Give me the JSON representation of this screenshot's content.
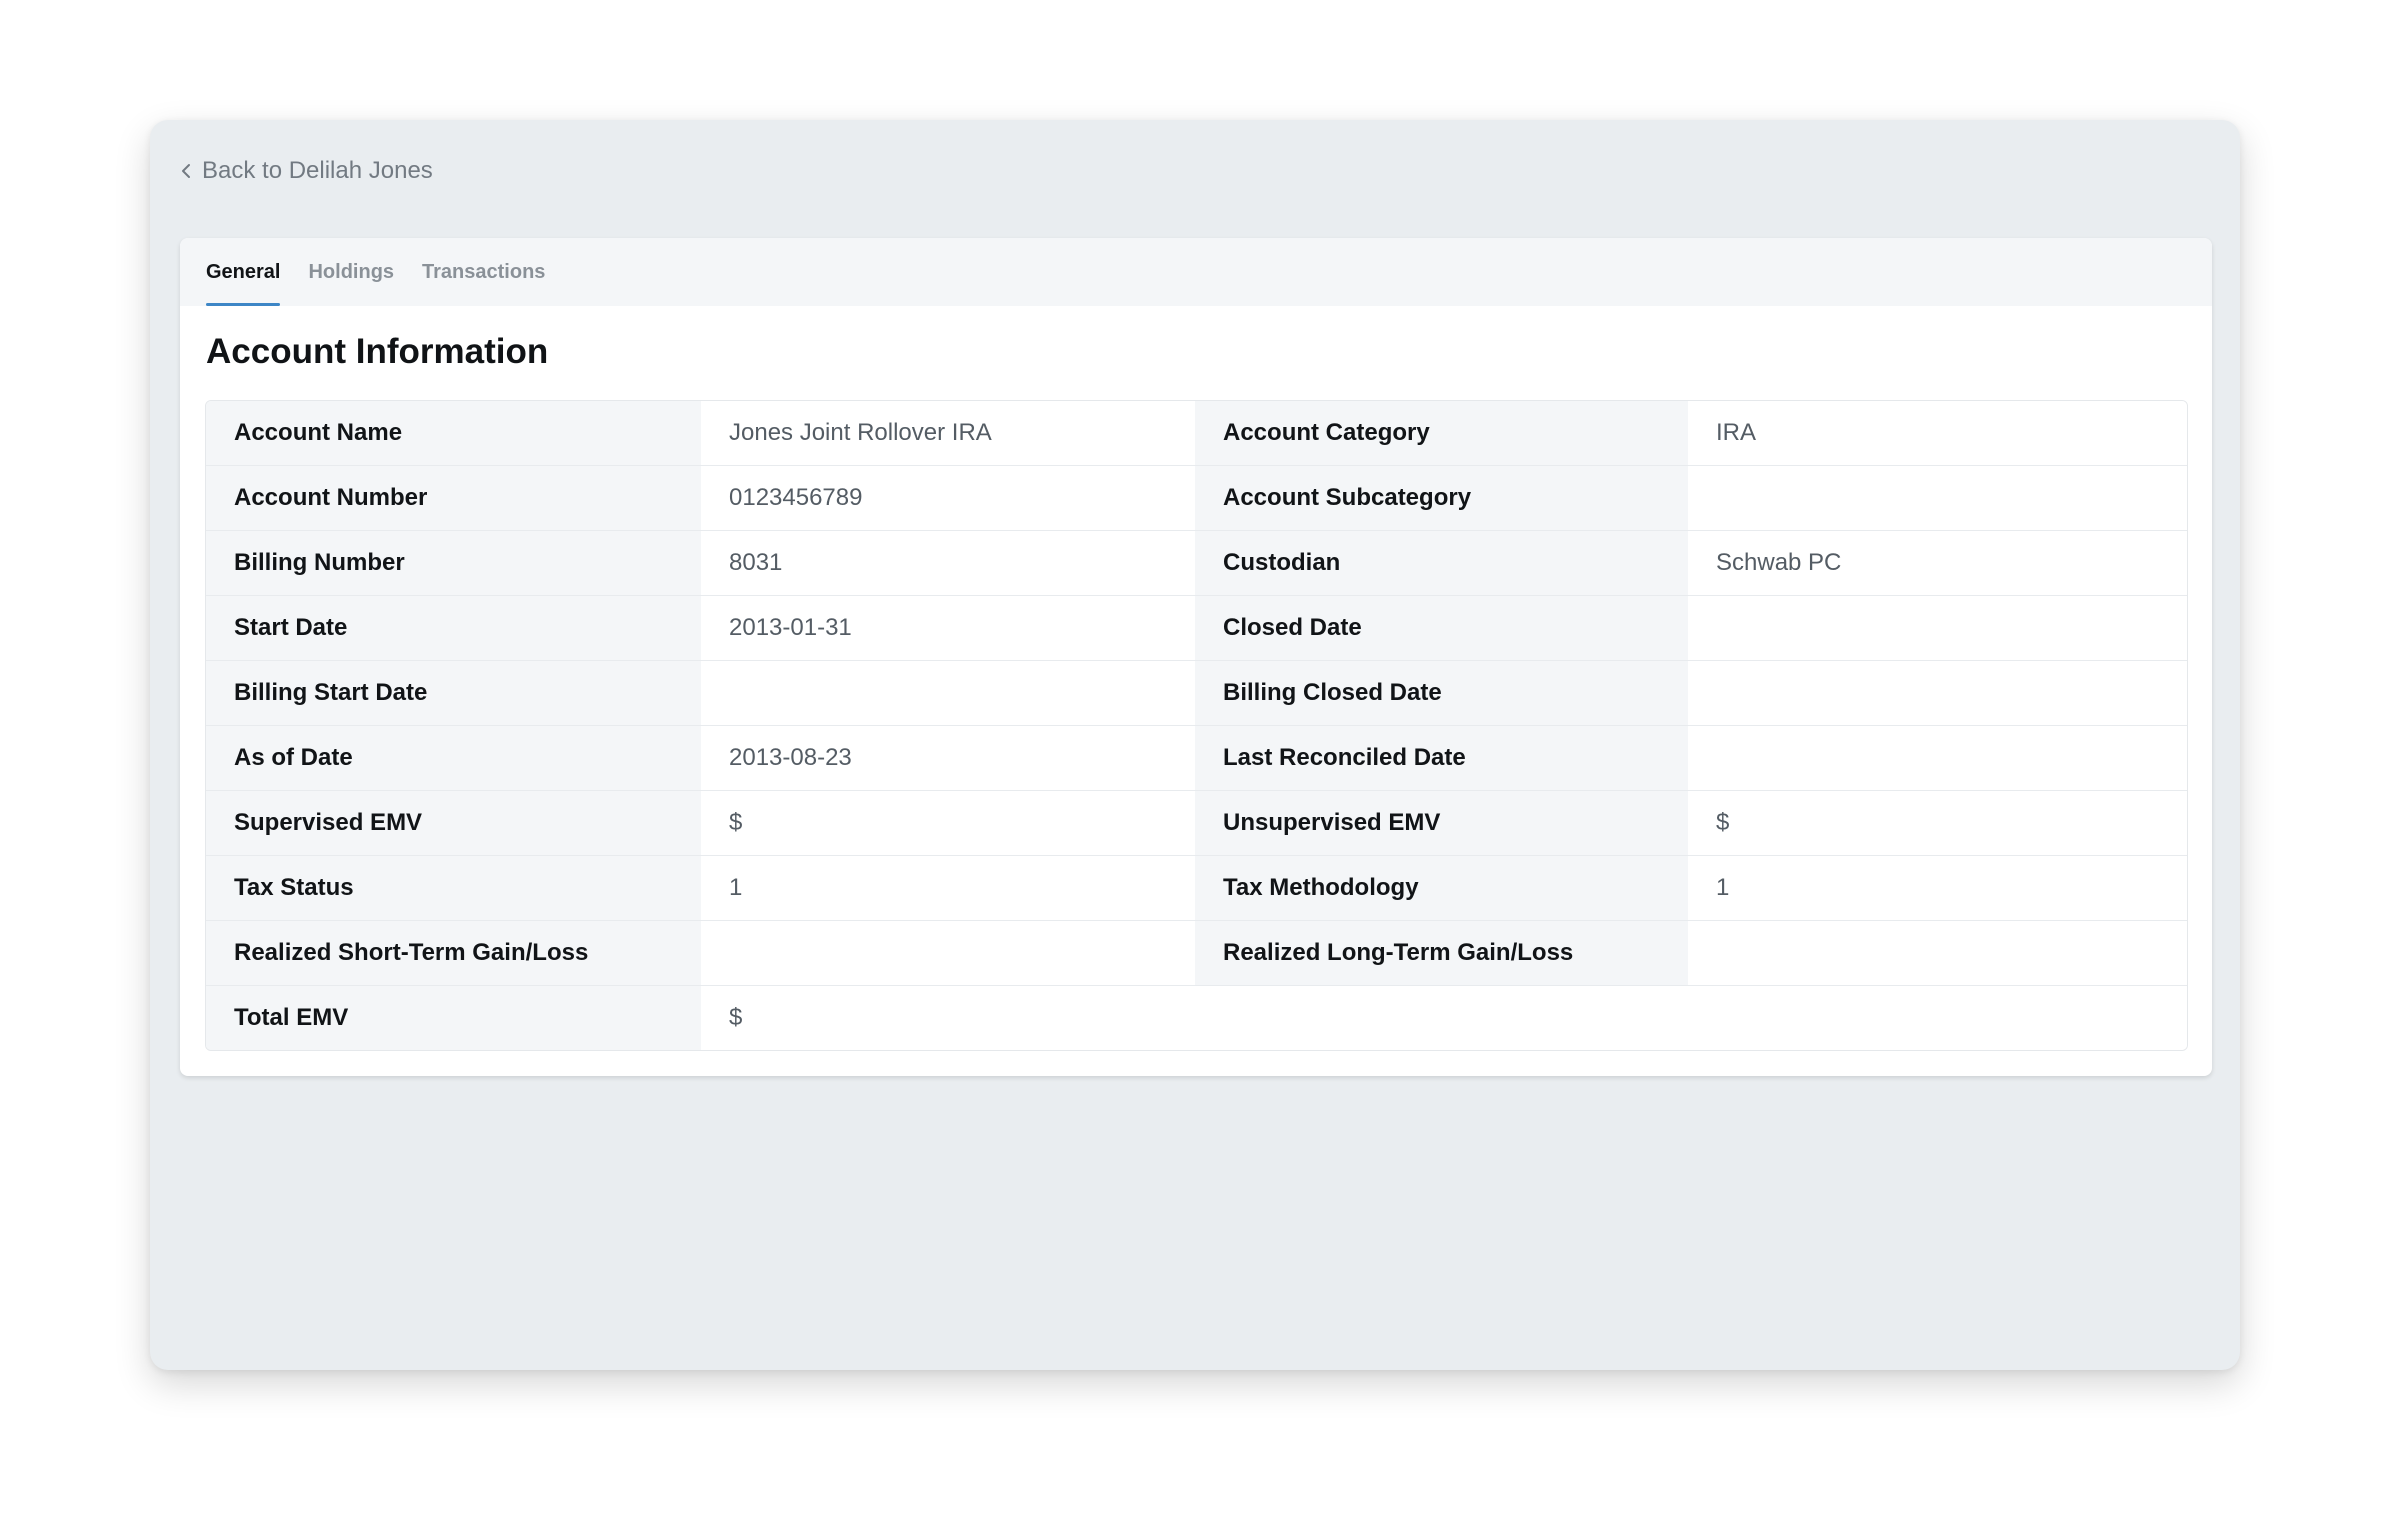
{
  "nav": {
    "back_label": "Back to Delilah Jones"
  },
  "tabs": [
    {
      "label": "General",
      "active": true
    },
    {
      "label": "Holdings",
      "active": false
    },
    {
      "label": "Transactions",
      "active": false
    }
  ],
  "section": {
    "title": "Account Information"
  },
  "rows": [
    {
      "l1": "Account Name",
      "v1": "Jones Joint Rollover IRA",
      "l2": "Account Category",
      "v2": "IRA"
    },
    {
      "l1": "Account Number",
      "v1": "0123456789",
      "l2": "Account Subcategory",
      "v2": ""
    },
    {
      "l1": "Billing Number",
      "v1": "8031",
      "l2": "Custodian",
      "v2": "Schwab PC"
    },
    {
      "l1": "Start Date",
      "v1": "2013-01-31",
      "l2": "Closed Date",
      "v2": ""
    },
    {
      "l1": "Billing Start Date",
      "v1": "",
      "l2": "Billing Closed Date",
      "v2": ""
    },
    {
      "l1": "As of Date",
      "v1": "2013-08-23",
      "l2": "Last Reconciled Date",
      "v2": ""
    },
    {
      "l1": "Supervised EMV",
      "v1": "$",
      "l2": "Unsupervised EMV",
      "v2": "$"
    },
    {
      "l1": "Tax Status",
      "v1": "1",
      "l2": "Tax Methodology",
      "v2": "1"
    },
    {
      "l1": "Realized Short-Term Gain/Loss",
      "v1": "",
      "l2": "Realized Long-Term Gain/Loss",
      "v2": ""
    }
  ],
  "total": {
    "label": "Total EMV",
    "value": "$"
  },
  "colors": {
    "accent": "#3d86c6",
    "page_bg": "#e9edf0",
    "label_bg": "#f4f6f8"
  }
}
